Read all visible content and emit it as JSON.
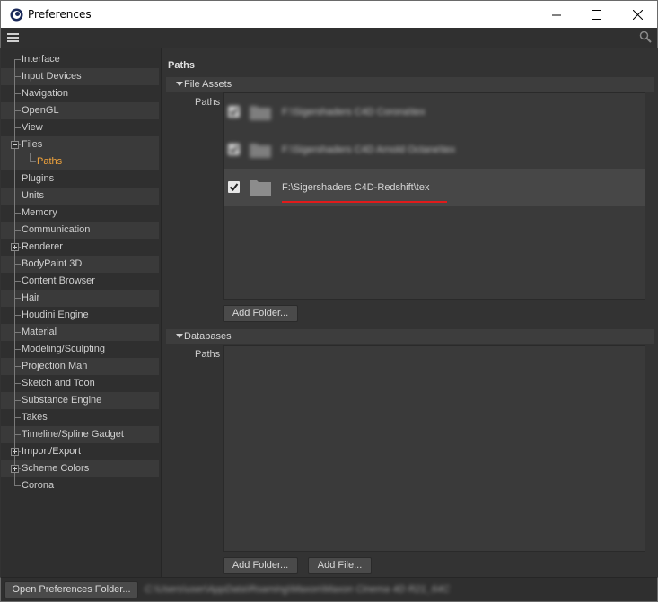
{
  "window": {
    "title": "Preferences",
    "minimize_icon": "minimize-icon",
    "maximize_icon": "maximize-icon",
    "close_icon": "close-icon"
  },
  "toolbar": {
    "menu_icon": "hamburger-menu-icon",
    "search_icon": "search-icon"
  },
  "sidebar": {
    "items": [
      {
        "label": "Interface"
      },
      {
        "label": "Input Devices"
      },
      {
        "label": "Navigation"
      },
      {
        "label": "OpenGL"
      },
      {
        "label": "View"
      },
      {
        "label": "Files"
      },
      {
        "label": "Paths"
      },
      {
        "label": "Plugins"
      },
      {
        "label": "Units"
      },
      {
        "label": "Memory"
      },
      {
        "label": "Communication"
      },
      {
        "label": "Renderer"
      },
      {
        "label": "BodyPaint 3D"
      },
      {
        "label": "Content Browser"
      },
      {
        "label": "Hair"
      },
      {
        "label": "Houdini Engine"
      },
      {
        "label": "Material"
      },
      {
        "label": "Modeling/Sculpting"
      },
      {
        "label": "Projection Man"
      },
      {
        "label": "Sketch and Toon"
      },
      {
        "label": "Substance Engine"
      },
      {
        "label": "Takes"
      },
      {
        "label": "Timeline/Spline Gadget"
      },
      {
        "label": "Import/Export"
      },
      {
        "label": "Scheme Colors"
      },
      {
        "label": "Corona"
      }
    ],
    "selected_color": "#f0a33c"
  },
  "main": {
    "section_title": "Paths",
    "file_assets": {
      "header": "File Assets",
      "field_label": "Paths",
      "paths": [
        {
          "text": "F:\\Sigershaders C4D Corona\\tex",
          "blurred": true,
          "checked": true
        },
        {
          "text": "F:\\Sigershaders C4D Arnold Octane\\tex",
          "blurred": true,
          "checked": true
        },
        {
          "text": "F:\\Sigershaders C4D-Redshift\\tex",
          "blurred": false,
          "checked": true
        }
      ],
      "add_folder_label": "Add Folder..."
    },
    "databases": {
      "header": "Databases",
      "field_label": "Paths",
      "add_folder_label": "Add Folder...",
      "add_file_label": "Add File..."
    }
  },
  "bottom": {
    "open_folder_label": "Open Preferences Folder...",
    "prefs_path": "C:\\Users\\user\\AppData\\Roaming\\Maxon\\Maxon Cinema 4D R21_64C"
  },
  "colors": {
    "accent_underline": "#e01b1b",
    "background": "#333333"
  }
}
